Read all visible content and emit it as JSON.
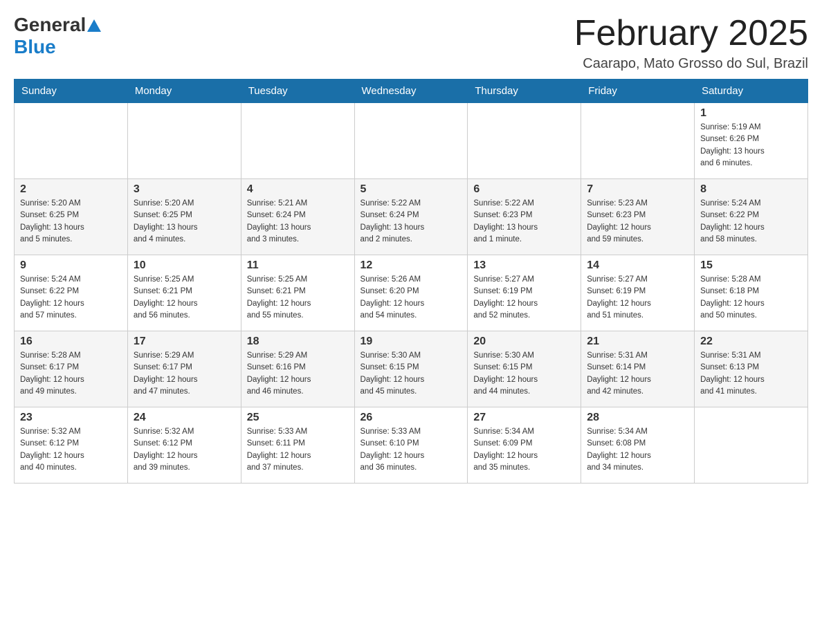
{
  "header": {
    "logo_general": "General",
    "logo_blue": "Blue",
    "month_title": "February 2025",
    "subtitle": "Caarapo, Mato Grosso do Sul, Brazil"
  },
  "days_of_week": [
    "Sunday",
    "Monday",
    "Tuesday",
    "Wednesday",
    "Thursday",
    "Friday",
    "Saturday"
  ],
  "weeks": [
    {
      "days": [
        {
          "number": "",
          "info": ""
        },
        {
          "number": "",
          "info": ""
        },
        {
          "number": "",
          "info": ""
        },
        {
          "number": "",
          "info": ""
        },
        {
          "number": "",
          "info": ""
        },
        {
          "number": "",
          "info": ""
        },
        {
          "number": "1",
          "info": "Sunrise: 5:19 AM\nSunset: 6:26 PM\nDaylight: 13 hours\nand 6 minutes."
        }
      ]
    },
    {
      "days": [
        {
          "number": "2",
          "info": "Sunrise: 5:20 AM\nSunset: 6:25 PM\nDaylight: 13 hours\nand 5 minutes."
        },
        {
          "number": "3",
          "info": "Sunrise: 5:20 AM\nSunset: 6:25 PM\nDaylight: 13 hours\nand 4 minutes."
        },
        {
          "number": "4",
          "info": "Sunrise: 5:21 AM\nSunset: 6:24 PM\nDaylight: 13 hours\nand 3 minutes."
        },
        {
          "number": "5",
          "info": "Sunrise: 5:22 AM\nSunset: 6:24 PM\nDaylight: 13 hours\nand 2 minutes."
        },
        {
          "number": "6",
          "info": "Sunrise: 5:22 AM\nSunset: 6:23 PM\nDaylight: 13 hours\nand 1 minute."
        },
        {
          "number": "7",
          "info": "Sunrise: 5:23 AM\nSunset: 6:23 PM\nDaylight: 12 hours\nand 59 minutes."
        },
        {
          "number": "8",
          "info": "Sunrise: 5:24 AM\nSunset: 6:22 PM\nDaylight: 12 hours\nand 58 minutes."
        }
      ]
    },
    {
      "days": [
        {
          "number": "9",
          "info": "Sunrise: 5:24 AM\nSunset: 6:22 PM\nDaylight: 12 hours\nand 57 minutes."
        },
        {
          "number": "10",
          "info": "Sunrise: 5:25 AM\nSunset: 6:21 PM\nDaylight: 12 hours\nand 56 minutes."
        },
        {
          "number": "11",
          "info": "Sunrise: 5:25 AM\nSunset: 6:21 PM\nDaylight: 12 hours\nand 55 minutes."
        },
        {
          "number": "12",
          "info": "Sunrise: 5:26 AM\nSunset: 6:20 PM\nDaylight: 12 hours\nand 54 minutes."
        },
        {
          "number": "13",
          "info": "Sunrise: 5:27 AM\nSunset: 6:19 PM\nDaylight: 12 hours\nand 52 minutes."
        },
        {
          "number": "14",
          "info": "Sunrise: 5:27 AM\nSunset: 6:19 PM\nDaylight: 12 hours\nand 51 minutes."
        },
        {
          "number": "15",
          "info": "Sunrise: 5:28 AM\nSunset: 6:18 PM\nDaylight: 12 hours\nand 50 minutes."
        }
      ]
    },
    {
      "days": [
        {
          "number": "16",
          "info": "Sunrise: 5:28 AM\nSunset: 6:17 PM\nDaylight: 12 hours\nand 49 minutes."
        },
        {
          "number": "17",
          "info": "Sunrise: 5:29 AM\nSunset: 6:17 PM\nDaylight: 12 hours\nand 47 minutes."
        },
        {
          "number": "18",
          "info": "Sunrise: 5:29 AM\nSunset: 6:16 PM\nDaylight: 12 hours\nand 46 minutes."
        },
        {
          "number": "19",
          "info": "Sunrise: 5:30 AM\nSunset: 6:15 PM\nDaylight: 12 hours\nand 45 minutes."
        },
        {
          "number": "20",
          "info": "Sunrise: 5:30 AM\nSunset: 6:15 PM\nDaylight: 12 hours\nand 44 minutes."
        },
        {
          "number": "21",
          "info": "Sunrise: 5:31 AM\nSunset: 6:14 PM\nDaylight: 12 hours\nand 42 minutes."
        },
        {
          "number": "22",
          "info": "Sunrise: 5:31 AM\nSunset: 6:13 PM\nDaylight: 12 hours\nand 41 minutes."
        }
      ]
    },
    {
      "days": [
        {
          "number": "23",
          "info": "Sunrise: 5:32 AM\nSunset: 6:12 PM\nDaylight: 12 hours\nand 40 minutes."
        },
        {
          "number": "24",
          "info": "Sunrise: 5:32 AM\nSunset: 6:12 PM\nDaylight: 12 hours\nand 39 minutes."
        },
        {
          "number": "25",
          "info": "Sunrise: 5:33 AM\nSunset: 6:11 PM\nDaylight: 12 hours\nand 37 minutes."
        },
        {
          "number": "26",
          "info": "Sunrise: 5:33 AM\nSunset: 6:10 PM\nDaylight: 12 hours\nand 36 minutes."
        },
        {
          "number": "27",
          "info": "Sunrise: 5:34 AM\nSunset: 6:09 PM\nDaylight: 12 hours\nand 35 minutes."
        },
        {
          "number": "28",
          "info": "Sunrise: 5:34 AM\nSunset: 6:08 PM\nDaylight: 12 hours\nand 34 minutes."
        },
        {
          "number": "",
          "info": ""
        }
      ]
    }
  ]
}
